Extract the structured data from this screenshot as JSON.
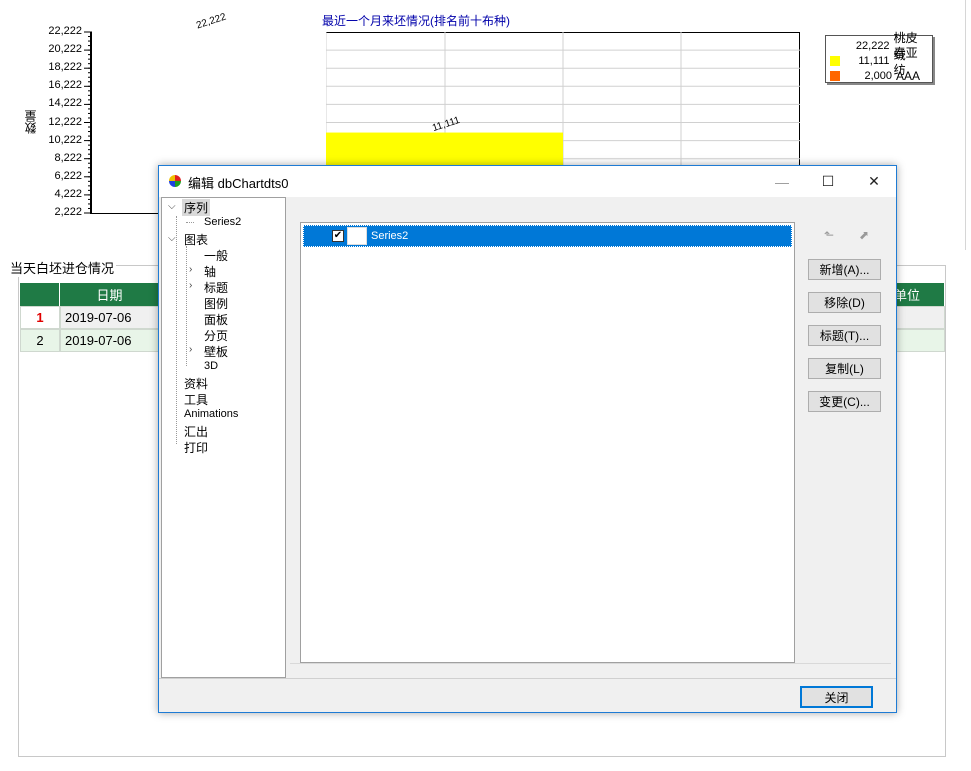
{
  "chart_data": {
    "type": "bar",
    "title": "最近一个月来坯情况(排名前十布种)",
    "ylabel": "数量",
    "xlabel": "",
    "ylim": [
      2222,
      22222
    ],
    "y_ticks": [
      "22,222",
      "20,222",
      "18,222",
      "16,222",
      "14,222",
      "12,222",
      "10,222",
      "8,222",
      "6,222",
      "4,222",
      "2,222"
    ],
    "categories": [
      "桃皮绒",
      "春亚纺",
      "AAA"
    ],
    "values": [
      22222,
      11111,
      2000
    ],
    "data_labels": [
      "22,222",
      "11,111"
    ],
    "colors": [
      "#ffffff",
      "#ffff00",
      "#ff6600"
    ],
    "legend": [
      {
        "value": "22,222",
        "label": "桃皮绒",
        "color": "#ffffff"
      },
      {
        "value": "11,111",
        "label": "春亚纺",
        "color": "#ffff00"
      },
      {
        "value": "2,000",
        "label": "AAA",
        "color": "#ff6600"
      }
    ],
    "legend_position": "top-right",
    "grid": true
  },
  "panel": {
    "title": "当天白坯进仓情况",
    "columns": [
      "日期",
      "单位"
    ],
    "rows": [
      {
        "num": "1",
        "date": "2019-07-06"
      },
      {
        "num": "2",
        "date": "2019-07-06"
      }
    ]
  },
  "dialog": {
    "title": "编辑 dbChartdts0",
    "minimize": "—",
    "maximize": "☐",
    "close": "✕",
    "tree": {
      "series": "序列",
      "series_item": "Series2",
      "chart": "图表",
      "general": "一般",
      "axis": "轴",
      "titles": "标题",
      "legend": "图例",
      "panel": "面板",
      "paging": "分页",
      "walls": "壁板",
      "three_d": "3D",
      "data": "资料",
      "tools": "工具",
      "animations": "Animations",
      "export": "汇出",
      "print": "打印"
    },
    "series_list": [
      {
        "name": "Series2",
        "checked": true
      }
    ],
    "buttons": {
      "add": "新增(A)...",
      "delete": "移除(D)",
      "title": "标题(T)...",
      "clone": "复制(L)",
      "change": "变更(C)..."
    },
    "close_button": "关闭"
  }
}
